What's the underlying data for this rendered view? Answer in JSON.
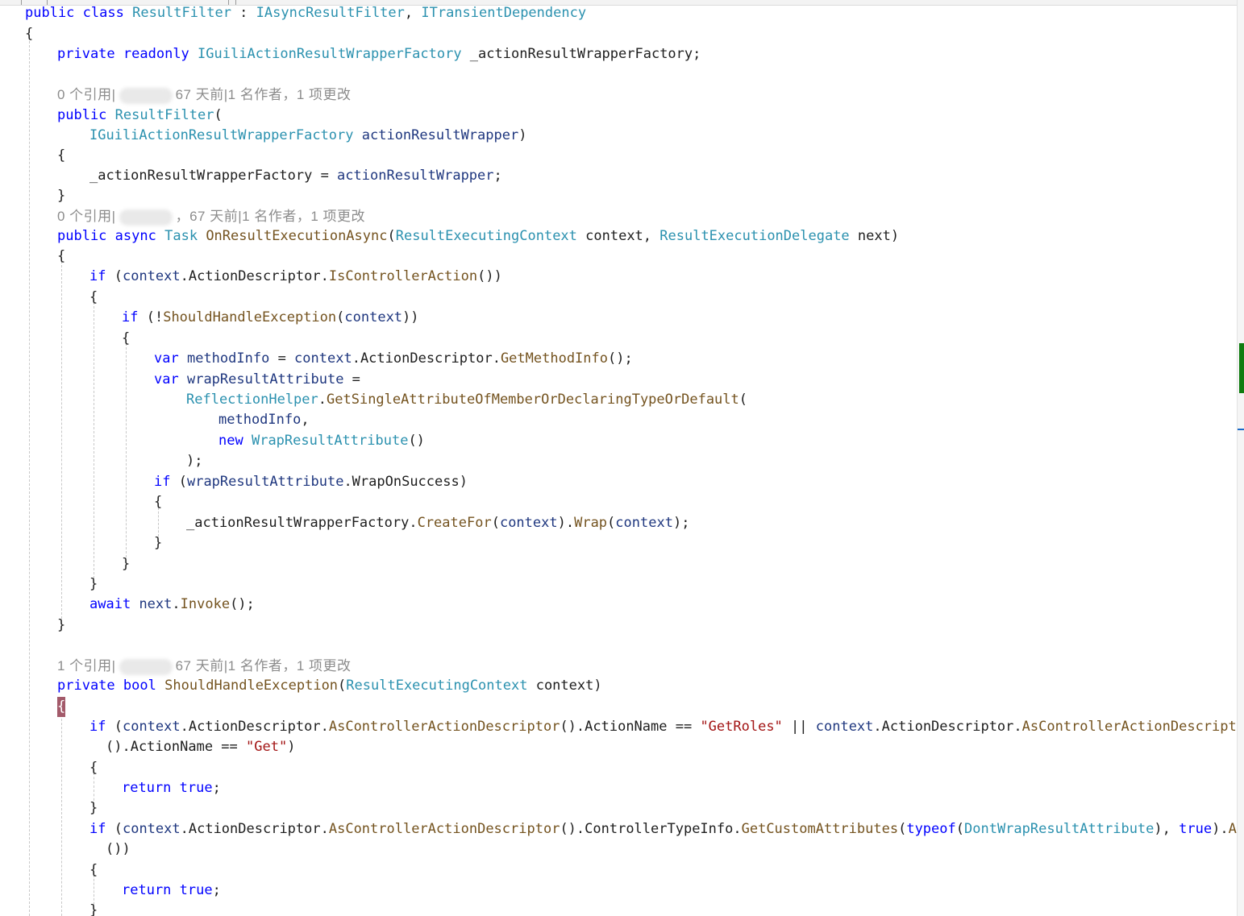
{
  "codelens": {
    "ctor": {
      "refs": "0 个引用|",
      "rest": "67 天前|1 名作者，1 项更改"
    },
    "exec": {
      "refs": "0 个引用|",
      "rest": "，67 天前|1 名作者，1 项更改"
    },
    "should": {
      "refs": "1 个引用|",
      "rest": "67 天前|1 名作者，1 项更改"
    }
  },
  "code": {
    "l01": {
      "a": "public",
      "b": "class",
      "c": "ResultFilter",
      "d": " : ",
      "e": "IAsyncResultFilter",
      "f": ", ",
      "g": "ITransientDependency"
    },
    "l02": {
      "a": "{"
    },
    "l03": {
      "a": "private",
      "b": "readonly",
      "c": "IGuiliActionResultWrapperFactory",
      "d": " _actionResultWrapperFactory;"
    },
    "l05": {
      "a": "public",
      "b": "ResultFilter",
      "c": "("
    },
    "l06": {
      "a": "IGuiliActionResultWrapperFactory",
      "b": " actionResultWrapper",
      "c": ")"
    },
    "l07": {
      "a": "{"
    },
    "l08": {
      "a": "_actionResultWrapperFactory = ",
      "b": "actionResultWrapper",
      "c": ";"
    },
    "l09": {
      "a": "}"
    },
    "l11": {
      "a": "public",
      "b": "async",
      "c": "Task",
      "d": "OnResultExecutionAsync",
      "e": "(",
      "f": "ResultExecutingContext",
      "g": " context, ",
      "h": "ResultExecutionDelegate",
      "i": " next)"
    },
    "l12": {
      "a": "{"
    },
    "l13": {
      "a": "if",
      "b": " (",
      "c": "context",
      "d": ".ActionDescriptor.",
      "e": "IsControllerAction",
      "f": "())"
    },
    "l14": {
      "a": "{"
    },
    "l15": {
      "a": "if",
      "b": " (!",
      "c": "ShouldHandleException",
      "d": "(",
      "e": "context",
      "f": "))"
    },
    "l16": {
      "a": "{"
    },
    "l17": {
      "a": "var",
      "b": "methodInfo",
      "c": " = ",
      "d": "context",
      "e": ".ActionDescriptor.",
      "f": "GetMethodInfo",
      "g": "();"
    },
    "l18": {
      "a": "var",
      "b": "wrapResultAttribute",
      "c": " ="
    },
    "l19": {
      "a": "ReflectionHelper",
      "b": ".",
      "c": "GetSingleAttributeOfMemberOrDeclaringTypeOrDefault",
      "d": "("
    },
    "l20": {
      "a": "methodInfo",
      "b": ","
    },
    "l21": {
      "a": "new",
      "b": "WrapResultAttribute",
      "c": "()"
    },
    "l22": {
      "a": ");"
    },
    "l23": {
      "a": "if",
      "b": " (",
      "c": "wrapResultAttribute",
      "d": ".WrapOnSuccess)"
    },
    "l24": {
      "a": "{"
    },
    "l25": {
      "a": "_actionResultWrapperFactory.",
      "b": "CreateFor",
      "c": "(",
      "d": "context",
      "e": ").",
      "f": "Wrap",
      "g": "(",
      "h": "context",
      "i": ");"
    },
    "l26": {
      "a": "}"
    },
    "l27": {
      "a": "}"
    },
    "l28": {
      "a": "}"
    },
    "l29": {
      "a": "await",
      "b": "next",
      "c": ".",
      "d": "Invoke",
      "e": "();"
    },
    "l30": {
      "a": "}"
    },
    "l33": {
      "a": "private",
      "b": "bool",
      "c": "ShouldHandleException",
      "d": "(",
      "e": "ResultExecutingContext",
      "f": " context)"
    },
    "l34": {
      "a": "{"
    },
    "l35": {
      "a": "if",
      "b": " (",
      "c": "context",
      "d": ".ActionDescriptor.",
      "e": "AsControllerActionDescriptor",
      "f": "().ActionName == ",
      "g": "\"GetRoles\"",
      "h": " || ",
      "i": "context",
      "j": ".ActionDescriptor.",
      "k": "AsControllerActionDescriptor"
    },
    "l36": {
      "a": "().ActionName == ",
      "b": "\"Get\"",
      "c": ")"
    },
    "l37": {
      "a": "{"
    },
    "l38": {
      "a": "return",
      "b": "true",
      "c": ";"
    },
    "l39": {
      "a": "}"
    },
    "l40": {
      "a": "if",
      "b": " (",
      "c": "context",
      "d": ".ActionDescriptor.",
      "e": "AsControllerActionDescriptor",
      "f": "().ControllerTypeInfo.",
      "g": "GetCustomAttributes",
      "h": "(",
      "i": "typeof",
      "j": "(",
      "k": "DontWrapResultAttribute",
      "l": "), ",
      "m": "true",
      "n": ").",
      "o": "Any"
    },
    "l41": {
      "a": "())"
    },
    "l42": {
      "a": "{"
    },
    "l43": {
      "a": "return",
      "b": "true",
      "c": ";"
    },
    "l44": {
      "a": "}"
    }
  },
  "icons": {
    "wrap": "word-wrap-arrow-icon"
  },
  "colors": {
    "keyword": "#0000ff",
    "type": "#2b91af",
    "method": "#74531f",
    "parameter": "#1f377f",
    "string": "#a31515",
    "codelens": "#8c8c8c",
    "brace_highlight": "#a35a6a",
    "scroll_added": "#107c10"
  }
}
